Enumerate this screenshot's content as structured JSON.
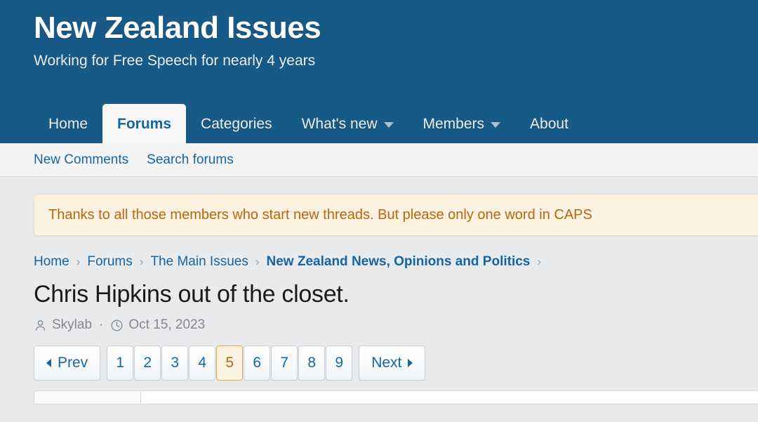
{
  "site": {
    "title": "New Zealand Issues",
    "tagline": "Working for Free Speech for nearly 4 years",
    "header_color": "#175a87",
    "link_color": "#1565a5",
    "accent_color": "#e8a83f"
  },
  "nav": {
    "items": [
      {
        "label": "Home",
        "active": false,
        "caret": false
      },
      {
        "label": "Forums",
        "active": true,
        "caret": false
      },
      {
        "label": "Categories",
        "active": false,
        "caret": false
      },
      {
        "label": "What's new",
        "active": false,
        "caret": true
      },
      {
        "label": "Members",
        "active": false,
        "caret": true
      },
      {
        "label": "About",
        "active": false,
        "caret": false
      }
    ]
  },
  "subnav": {
    "items": [
      {
        "label": "New Comments"
      },
      {
        "label": "Search forums"
      }
    ]
  },
  "notice": {
    "text": "Thanks to all those members who start new threads. But please only one word in CAPS",
    "background": "#fdf1e0",
    "text_color": "#b4690e"
  },
  "breadcrumb": {
    "items": [
      {
        "label": "Home",
        "current": false
      },
      {
        "label": "Forums",
        "current": false
      },
      {
        "label": "The Main Issues",
        "current": false
      },
      {
        "label": "New Zealand News, Opinions and Politics",
        "current": true
      }
    ],
    "separator": "›"
  },
  "thread": {
    "title": "Chris Hipkins out of the closet.",
    "author": "Skylab",
    "separator_dot": "·",
    "date": "Oct 15, 2023",
    "author_icon": "user-icon",
    "date_icon": "clock-icon"
  },
  "pagination": {
    "prev_label": "Prev",
    "next_label": "Next",
    "pages": [
      "1",
      "2",
      "3",
      "4",
      "5",
      "6",
      "7",
      "8",
      "9"
    ],
    "current_page": "5"
  }
}
